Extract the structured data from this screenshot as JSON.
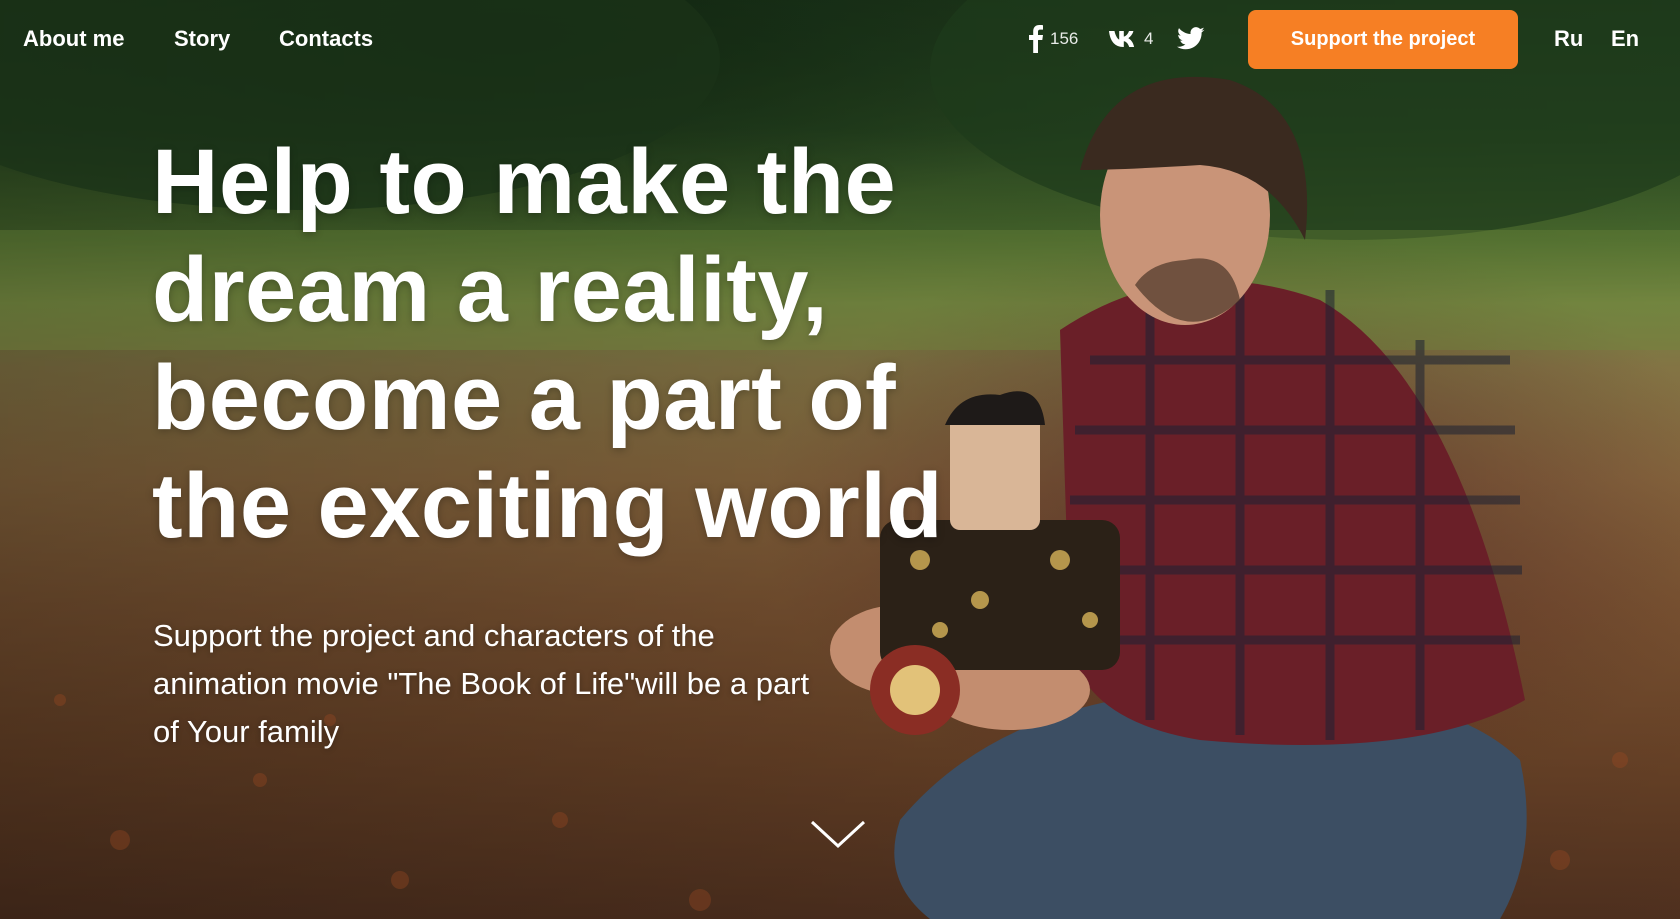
{
  "nav": {
    "items": [
      {
        "label": "About me"
      },
      {
        "label": "Story"
      },
      {
        "label": "Contacts"
      }
    ]
  },
  "social": {
    "facebook": {
      "icon": "facebook-icon",
      "count": "156"
    },
    "vk": {
      "icon": "vk-icon",
      "count": "4"
    },
    "twitter": {
      "icon": "twitter-icon"
    }
  },
  "cta": {
    "label": "Support the project",
    "color": "#f67f24"
  },
  "languages": [
    "Ru",
    "En"
  ],
  "hero": {
    "headline": "Help to make the dream a reality, become a part of the exciting world",
    "subtext": "Support the project and characters of the animation movie \"The Book of Life\"will be a part of Your family",
    "scroll_icon": "chevron-down-icon"
  }
}
